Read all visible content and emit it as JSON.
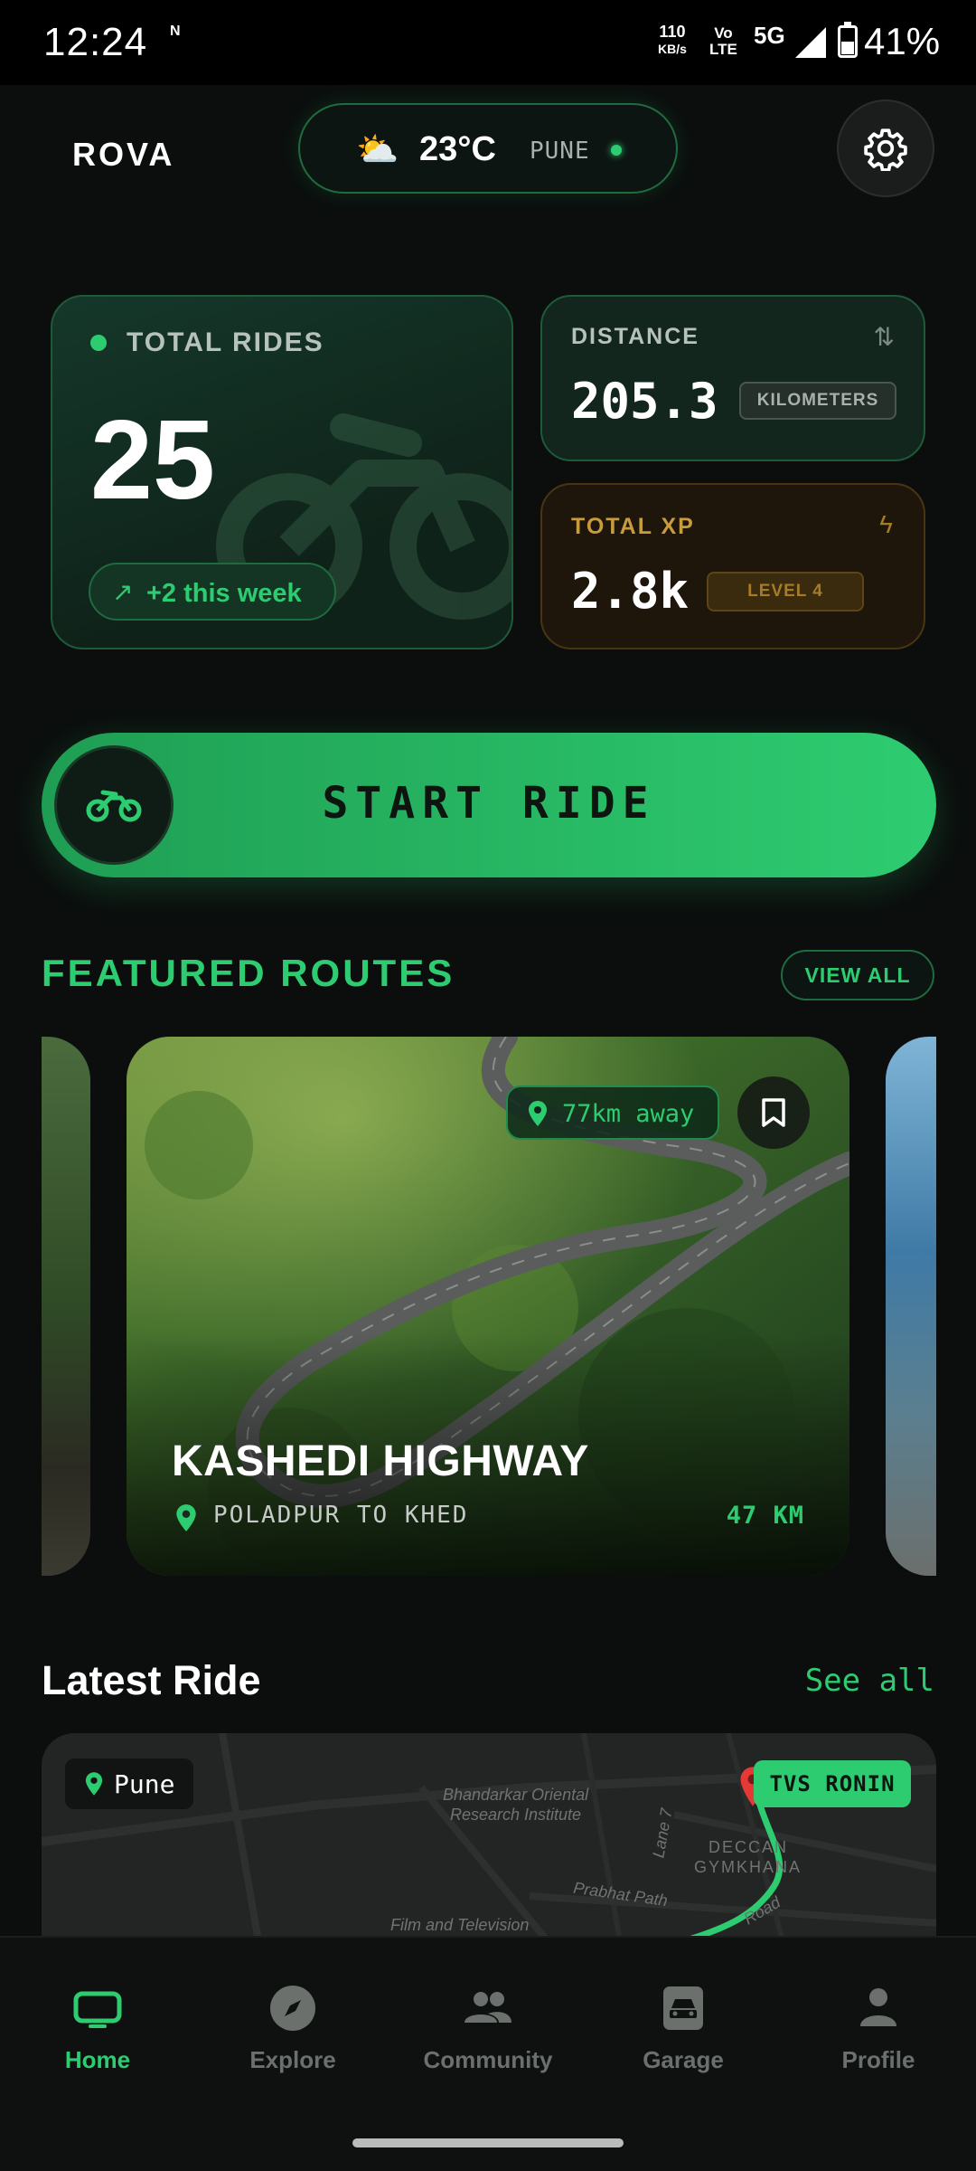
{
  "status_bar": {
    "time": "12:24",
    "network_icon_text": "N",
    "speed_value": "110",
    "speed_unit": "KB/s",
    "volte_top": "Vo",
    "volte_bottom": "LTE",
    "network_type": "5G",
    "battery": "41%"
  },
  "header": {
    "logo": "ROVA",
    "weather": {
      "icon": "partly-cloudy-icon",
      "temperature": "23°C",
      "city": "PUNE"
    },
    "settings_icon": "gear-icon"
  },
  "stats": {
    "total_rides": {
      "label": "TOTAL RIDES",
      "value": "25",
      "delta": "+2 this week"
    },
    "distance": {
      "label": "DISTANCE",
      "value": "205.3",
      "unit": "KILOMETERS"
    },
    "total_xp": {
      "label": "TOTAL XP",
      "value": "2.8k",
      "level": "LEVEL 4"
    }
  },
  "start_ride": {
    "label": "START RIDE",
    "icon": "motorcycle-icon"
  },
  "featured": {
    "title": "FEATURED ROUTES",
    "view_all": "VIEW ALL",
    "route": {
      "name": "KASHEDI HIGHWAY",
      "subtitle": "POLADPUR TO KHED",
      "distance": "47 KM",
      "away": "77km away"
    }
  },
  "latest_ride": {
    "title": "Latest Ride",
    "see_all": "See all",
    "location": "Pune",
    "bike": "TVS RONIN",
    "map_labels": {
      "institute_line1": "Bhandarkar Oriental",
      "institute_line2": "Research Institute",
      "lane": "Lane 7",
      "deccan_line1": "DECCAN",
      "deccan_line2": "GYMKHANA",
      "prabhat": "Prabhat Path",
      "film": "Film and Television",
      "road": "Road"
    }
  },
  "nav": {
    "items": [
      {
        "label": "Home",
        "icon": "home-icon",
        "active": true
      },
      {
        "label": "Explore",
        "icon": "compass-icon",
        "active": false
      },
      {
        "label": "Community",
        "icon": "people-icon",
        "active": false
      },
      {
        "label": "Garage",
        "icon": "car-icon",
        "active": false
      },
      {
        "label": "Profile",
        "icon": "person-icon",
        "active": false
      }
    ]
  },
  "colors": {
    "accent": "#2ecc71",
    "background": "#0b0e0d",
    "xp": "#c89c3c"
  }
}
